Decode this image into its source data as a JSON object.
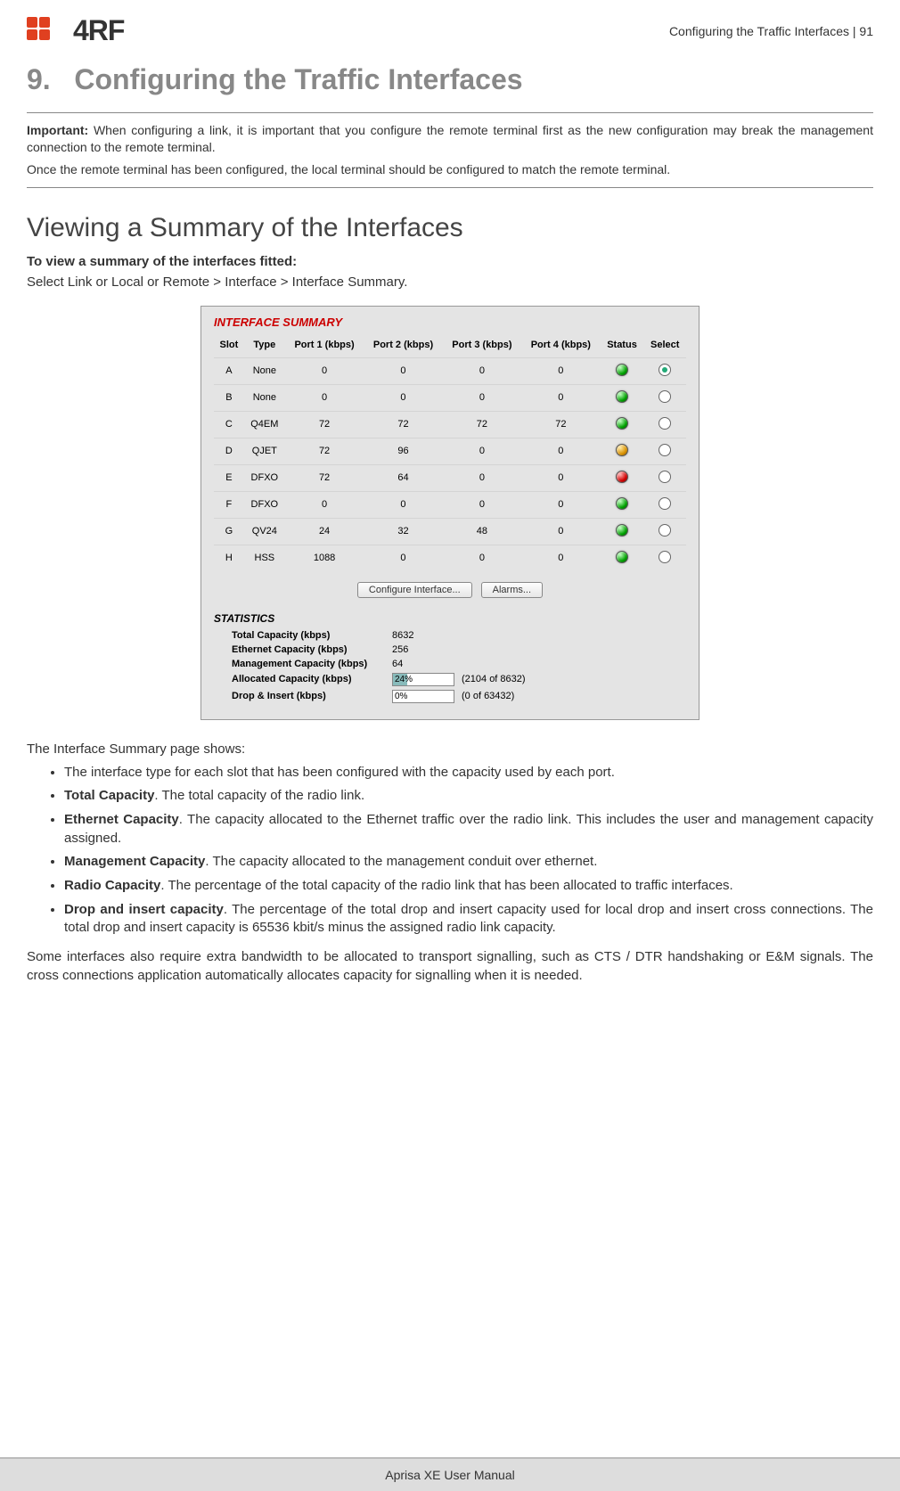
{
  "header": {
    "logo_text": "4RF",
    "right_text": "Configuring the Traffic Interfaces  |  91"
  },
  "chapter": {
    "number": "9.",
    "title": "Configuring the Traffic Interfaces"
  },
  "important_note": {
    "para1_bold": "Important:",
    "para1": " When configuring a link, it is important that you configure the remote terminal first as the new configuration may break the management connection to the remote terminal.",
    "para2": "Once the remote terminal has been configured, the local terminal should be configured to match the remote terminal."
  },
  "section": {
    "title": "Viewing a Summary of the Interfaces",
    "subhead": "To view a summary of the interfaces fitted:",
    "nav_path": "Select Link or Local or Remote > Interface > Interface Summary."
  },
  "panel": {
    "title": "INTERFACE SUMMARY",
    "columns": [
      "Slot",
      "Type",
      "Port 1 (kbps)",
      "Port 2 (kbps)",
      "Port 3 (kbps)",
      "Port 4 (kbps)",
      "Status",
      "Select"
    ],
    "rows": [
      {
        "slot": "A",
        "type": "None",
        "p1": "0",
        "p2": "0",
        "p3": "0",
        "p4": "0",
        "status": "green",
        "selected": true
      },
      {
        "slot": "B",
        "type": "None",
        "p1": "0",
        "p2": "0",
        "p3": "0",
        "p4": "0",
        "status": "green",
        "selected": false
      },
      {
        "slot": "C",
        "type": "Q4EM",
        "p1": "72",
        "p2": "72",
        "p3": "72",
        "p4": "72",
        "status": "green",
        "selected": false
      },
      {
        "slot": "D",
        "type": "QJET",
        "p1": "72",
        "p2": "96",
        "p3": "0",
        "p4": "0",
        "status": "amber",
        "selected": false
      },
      {
        "slot": "E",
        "type": "DFXO",
        "p1": "72",
        "p2": "64",
        "p3": "0",
        "p4": "0",
        "status": "red",
        "selected": false
      },
      {
        "slot": "F",
        "type": "DFXO",
        "p1": "0",
        "p2": "0",
        "p3": "0",
        "p4": "0",
        "status": "green",
        "selected": false
      },
      {
        "slot": "G",
        "type": "QV24",
        "p1": "24",
        "p2": "32",
        "p3": "48",
        "p4": "0",
        "status": "green",
        "selected": false
      },
      {
        "slot": "H",
        "type": "HSS",
        "p1": "1088",
        "p2": "0",
        "p3": "0",
        "p4": "0",
        "status": "green",
        "selected": false
      }
    ],
    "buttons": {
      "configure": "Configure Interface...",
      "alarms": "Alarms..."
    },
    "stats_title": "STATISTICS",
    "stats": {
      "total_cap_label": "Total Capacity (kbps)",
      "total_cap_value": "8632",
      "eth_cap_label": "Ethernet Capacity (kbps)",
      "eth_cap_value": "256",
      "mgmt_cap_label": "Management Capacity (kbps)",
      "mgmt_cap_value": "64",
      "alloc_cap_label": "Allocated Capacity (kbps)",
      "alloc_cap_pct": "24%",
      "alloc_cap_detail": "(2104 of 8632)",
      "drop_ins_label": "Drop & Insert (kbps)",
      "drop_ins_pct": "0%",
      "drop_ins_detail": "(0 of 63432)"
    }
  },
  "description": {
    "lead": "The Interface Summary page shows:",
    "bullets": {
      "b1": "The interface type for each slot that has been configured with the capacity used by each port.",
      "b2_bold": "Total Capacity",
      "b2": ". The total capacity of the radio link.",
      "b3_bold": "Ethernet Capacity",
      "b3": ". The capacity allocated to the Ethernet traffic over the radio link. This includes the user and management capacity assigned.",
      "b4_bold": "Management Capacity",
      "b4": ". The capacity allocated to the management conduit over ethernet.",
      "b5_bold": "Radio Capacity",
      "b5": ". The percentage of the total capacity of the radio link that has been allocated to traffic interfaces.",
      "b6_bold": "Drop and insert capacity",
      "b6": ". The percentage of the total drop and insert capacity used for local drop and insert cross connections. The total drop and insert capacity is 65536 kbit/s minus the assigned radio link capacity."
    },
    "tail": "Some interfaces also require extra bandwidth to be allocated to transport signalling, such as CTS / DTR handshaking or E&M signals. The cross connections application automatically allocates capacity for signalling when it is needed."
  },
  "footer": {
    "text": "Aprisa XE User Manual"
  }
}
